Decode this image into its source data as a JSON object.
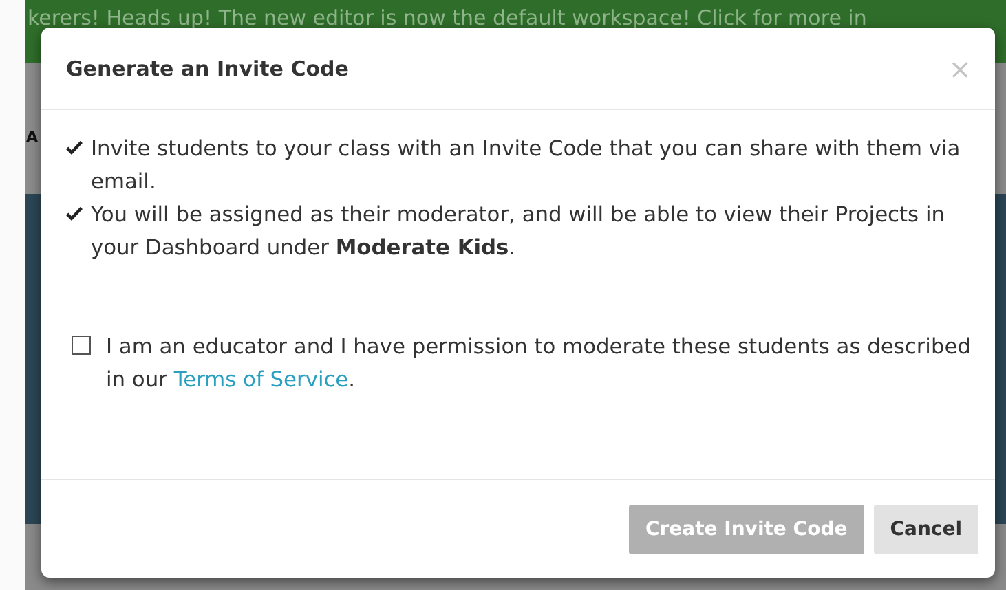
{
  "banner": {
    "text": "kerers! Heads up! The new editor is now the default workspace!  Click for more in"
  },
  "backdrop": {
    "label": "A"
  },
  "dialog": {
    "title": "Generate an Invite Code",
    "close": "×",
    "bullets": [
      "Invite students to your class with an Invite Code that you can share with them via email.",
      "You will be assigned as their moderator, and will be able to view their Projects in your Dashboard under **Moderate Kids**."
    ],
    "consent": {
      "checked": false,
      "text": "I am an educator and I have permission to moderate these students as described in our ",
      "link": "Terms of Service",
      "suffix": "."
    },
    "buttons": [
      {
        "label": "Create Invite Code",
        "kind": "primary",
        "disabled": true
      },
      {
        "label": "Cancel",
        "kind": "secondary",
        "disabled": false
      }
    ]
  }
}
